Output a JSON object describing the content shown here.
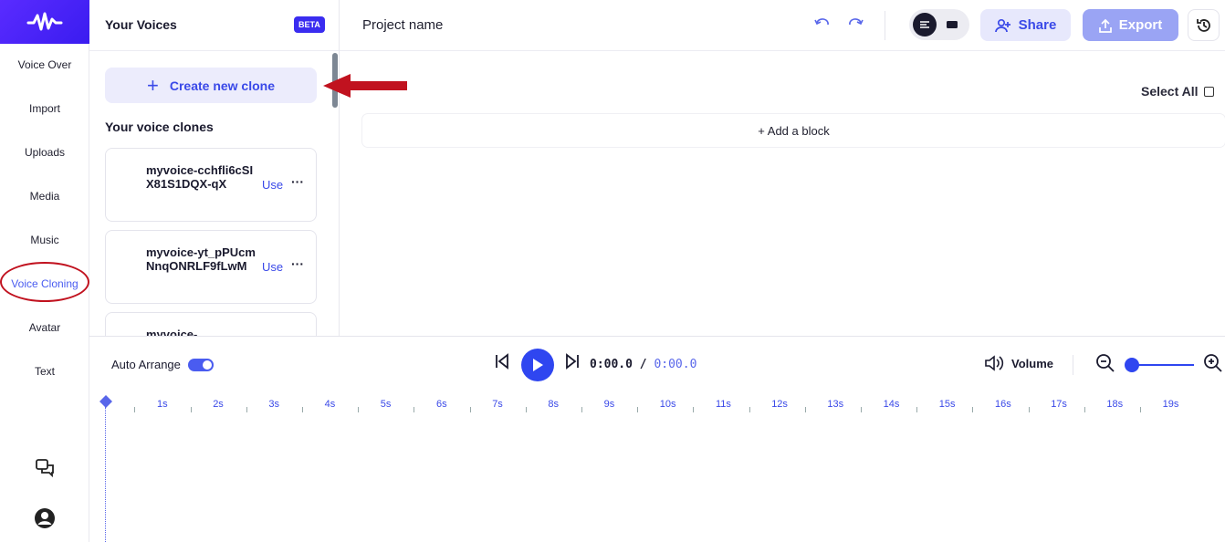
{
  "sidebar": {
    "items": [
      {
        "label": "Voice Over"
      },
      {
        "label": "Import"
      },
      {
        "label": "Uploads"
      },
      {
        "label": "Media"
      },
      {
        "label": "Music"
      },
      {
        "label": "Voice Cloning",
        "active": true
      },
      {
        "label": "Avatar"
      },
      {
        "label": "Text"
      }
    ],
    "bottom_icons": [
      "chat-icon",
      "user-avatar-icon"
    ]
  },
  "voices_panel": {
    "title": "Your Voices",
    "badge": "BETA",
    "create_label": "Create new clone",
    "clones_title": "Your voice clones",
    "clones": [
      {
        "name": "myvoice-cchfli6cSIX81S1DQX-qX",
        "use_label": "Use",
        "more": "···"
      },
      {
        "name": "myvoice-yt_pPUcmNnqONRLF9fLwM",
        "use_label": "Use",
        "more": "···"
      },
      {
        "name": "myvoice-",
        "use_label": "",
        "more": ""
      }
    ]
  },
  "header": {
    "project_name": "Project name",
    "share_label": "Share",
    "export_label": "Export"
  },
  "editor": {
    "select_all_label": "Select All",
    "add_block_label": "+ Add a block"
  },
  "timeline": {
    "auto_arrange_label": "Auto Arrange",
    "auto_arrange_on": true,
    "current_time": "0:00.0",
    "separator": "/",
    "total_time": "0:00.0",
    "volume_label": "Volume",
    "ticks": [
      "1s",
      "2s",
      "3s",
      "4s",
      "5s",
      "6s",
      "7s",
      "8s",
      "9s",
      "10s",
      "11s",
      "12s",
      "13s",
      "14s",
      "15s",
      "16s",
      "17s",
      "18s",
      "19s"
    ]
  },
  "colors": {
    "accent": "#3a49e8",
    "brand": "#5a2bff",
    "annotation": "#c1121f"
  }
}
